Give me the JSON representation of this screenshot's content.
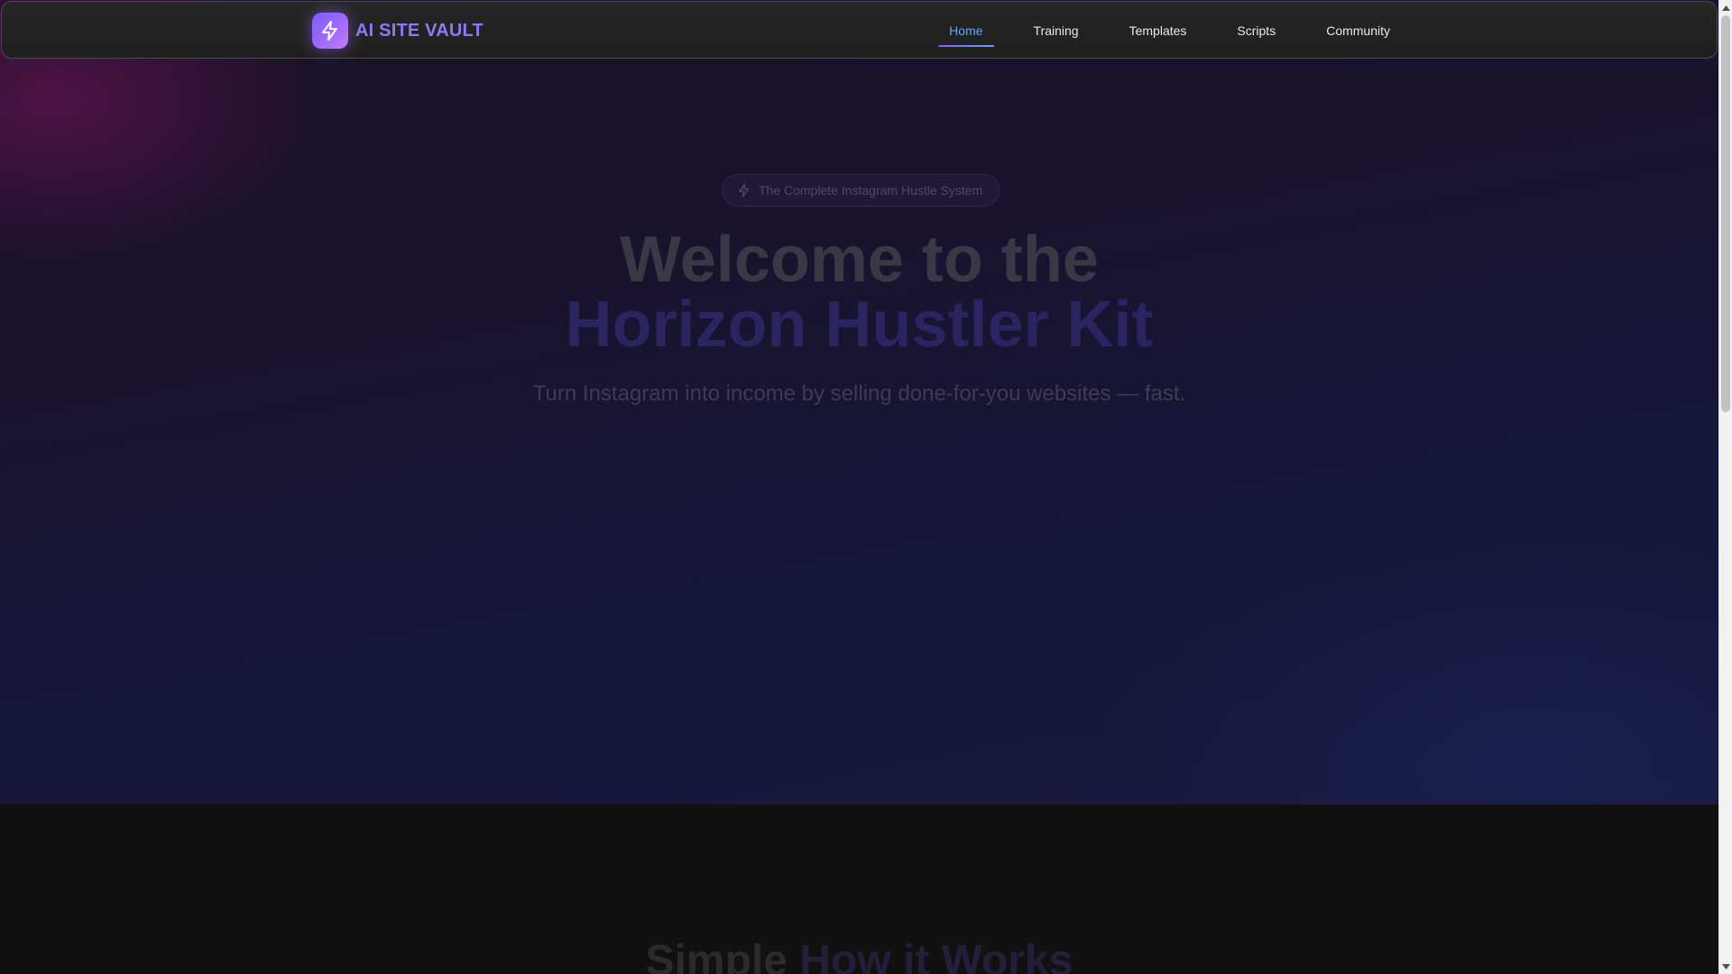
{
  "brand": {
    "name": "AI SITE VAULT",
    "logo_icon": "lightning-bolt-icon"
  },
  "nav": {
    "items": [
      {
        "label": "Home",
        "active": true
      },
      {
        "label": "Training",
        "active": false
      },
      {
        "label": "Templates",
        "active": false
      },
      {
        "label": "Scripts",
        "active": false
      },
      {
        "label": "Community",
        "active": false
      }
    ]
  },
  "hero": {
    "badge_icon": "lightning-bolt-icon",
    "badge": "The Complete Instagram Hustle System",
    "title_line1": "Welcome to the",
    "title_line2": "Horizon Hustler Kit",
    "subtitle": "Turn Instagram into income by selling done-for-you websites — fast."
  },
  "how_it_works": {
    "title_part1": "Simple",
    "title_part2": "How it Works"
  },
  "colors": {
    "accent_purple": "#8b5cf6",
    "active_link": "#60a5fa",
    "brand_text": "#8a7cf0"
  }
}
